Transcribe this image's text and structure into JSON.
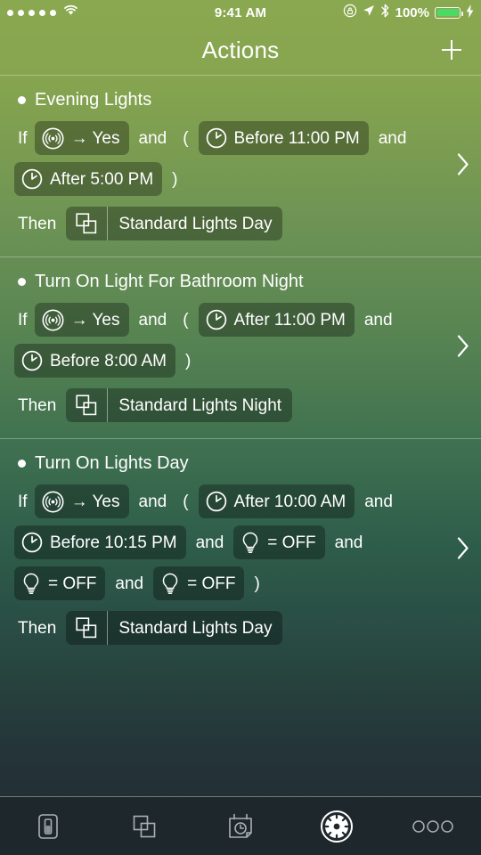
{
  "status_bar": {
    "signal_dots": 5,
    "wifi_icon": "wifi-icon",
    "time": "9:41 AM",
    "orientation_lock_icon": "rotation-lock-icon",
    "location_icon": "location-arrow-icon",
    "bluetooth_icon": "bluetooth-icon",
    "battery_percent": "100%",
    "battery_level": 100,
    "charging": true,
    "battery_color": "#4cd964"
  },
  "navbar": {
    "title": "Actions",
    "add_button_label": "+"
  },
  "keywords": {
    "if": "If",
    "then": "Then",
    "and": "and",
    "open_paren": "(",
    "close_paren": ")",
    "arrow": "→"
  },
  "actions": [
    {
      "name": "Evening Lights",
      "conditions": [
        {
          "kind": "pill",
          "icon": "sensor-icon",
          "text": "→ Yes"
        },
        {
          "kind": "kw",
          "text": "and"
        },
        {
          "kind": "kw",
          "text": "("
        },
        {
          "kind": "pill",
          "icon": "clock-icon",
          "text": "Before 11:00 PM"
        },
        {
          "kind": "kw",
          "text": "and"
        },
        {
          "kind": "pill",
          "icon": "clock-icon",
          "text": "After 5:00 PM"
        },
        {
          "kind": "kw",
          "text": ")"
        }
      ],
      "result": {
        "icon": "scene-icon",
        "text": "Standard Lights Day"
      }
    },
    {
      "name": "Turn On Light For Bathroom Night",
      "conditions": [
        {
          "kind": "pill",
          "icon": "sensor-icon",
          "text": "→ Yes"
        },
        {
          "kind": "kw",
          "text": "and"
        },
        {
          "kind": "kw",
          "text": "("
        },
        {
          "kind": "pill",
          "icon": "clock-icon",
          "text": "After 11:00 PM"
        },
        {
          "kind": "kw",
          "text": "and"
        },
        {
          "kind": "pill",
          "icon": "clock-icon",
          "text": "Before 8:00 AM"
        },
        {
          "kind": "kw",
          "text": ")"
        }
      ],
      "result": {
        "icon": "scene-icon",
        "text": "Standard Lights Night"
      }
    },
    {
      "name": "Turn On Lights Day",
      "conditions": [
        {
          "kind": "pill",
          "icon": "sensor-icon",
          "text": "→ Yes"
        },
        {
          "kind": "kw",
          "text": "and"
        },
        {
          "kind": "kw",
          "text": "("
        },
        {
          "kind": "pill",
          "icon": "clock-icon",
          "text": "After 10:00 AM"
        },
        {
          "kind": "kw",
          "text": "and"
        },
        {
          "kind": "pill",
          "icon": "clock-icon",
          "text": "Before 10:15 PM"
        },
        {
          "kind": "kw",
          "text": "and"
        },
        {
          "kind": "pill",
          "icon": "bulb-icon",
          "text": "= OFF"
        },
        {
          "kind": "kw",
          "text": "and"
        },
        {
          "kind": "pill",
          "icon": "bulb-icon",
          "text": "= OFF"
        },
        {
          "kind": "kw",
          "text": "and"
        },
        {
          "kind": "pill",
          "icon": "bulb-icon",
          "text": "= OFF"
        },
        {
          "kind": "kw",
          "text": ")"
        }
      ],
      "result": {
        "icon": "scene-icon",
        "text": "Standard Lights Day"
      }
    }
  ],
  "tabbar": {
    "items": [
      {
        "id": "devices",
        "icon": "light-switch-icon",
        "selected": false
      },
      {
        "id": "scenes",
        "icon": "scene-icon",
        "selected": false
      },
      {
        "id": "schedules",
        "icon": "calendar-clock-icon",
        "selected": false
      },
      {
        "id": "actions",
        "icon": "actions-wheel-icon",
        "selected": true
      },
      {
        "id": "more",
        "icon": "ellipsis-icon",
        "selected": false
      }
    ]
  }
}
